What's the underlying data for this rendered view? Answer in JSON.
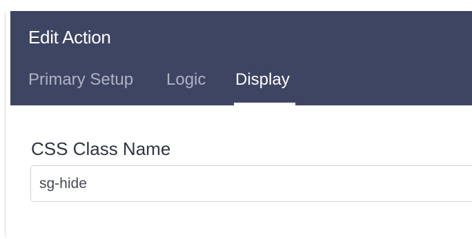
{
  "dialog": {
    "title": "Edit Action",
    "tabs": [
      {
        "label": "Primary Setup",
        "active": false
      },
      {
        "label": "Logic",
        "active": false
      },
      {
        "label": "Display",
        "active": true
      }
    ]
  },
  "form": {
    "css_class_label": "CSS Class Name",
    "css_class_value": "sg-hide"
  },
  "colors": {
    "header_background": "#3e4563",
    "tab_inactive_text": "#aeb3c5",
    "tab_active_text": "#ffffff"
  }
}
